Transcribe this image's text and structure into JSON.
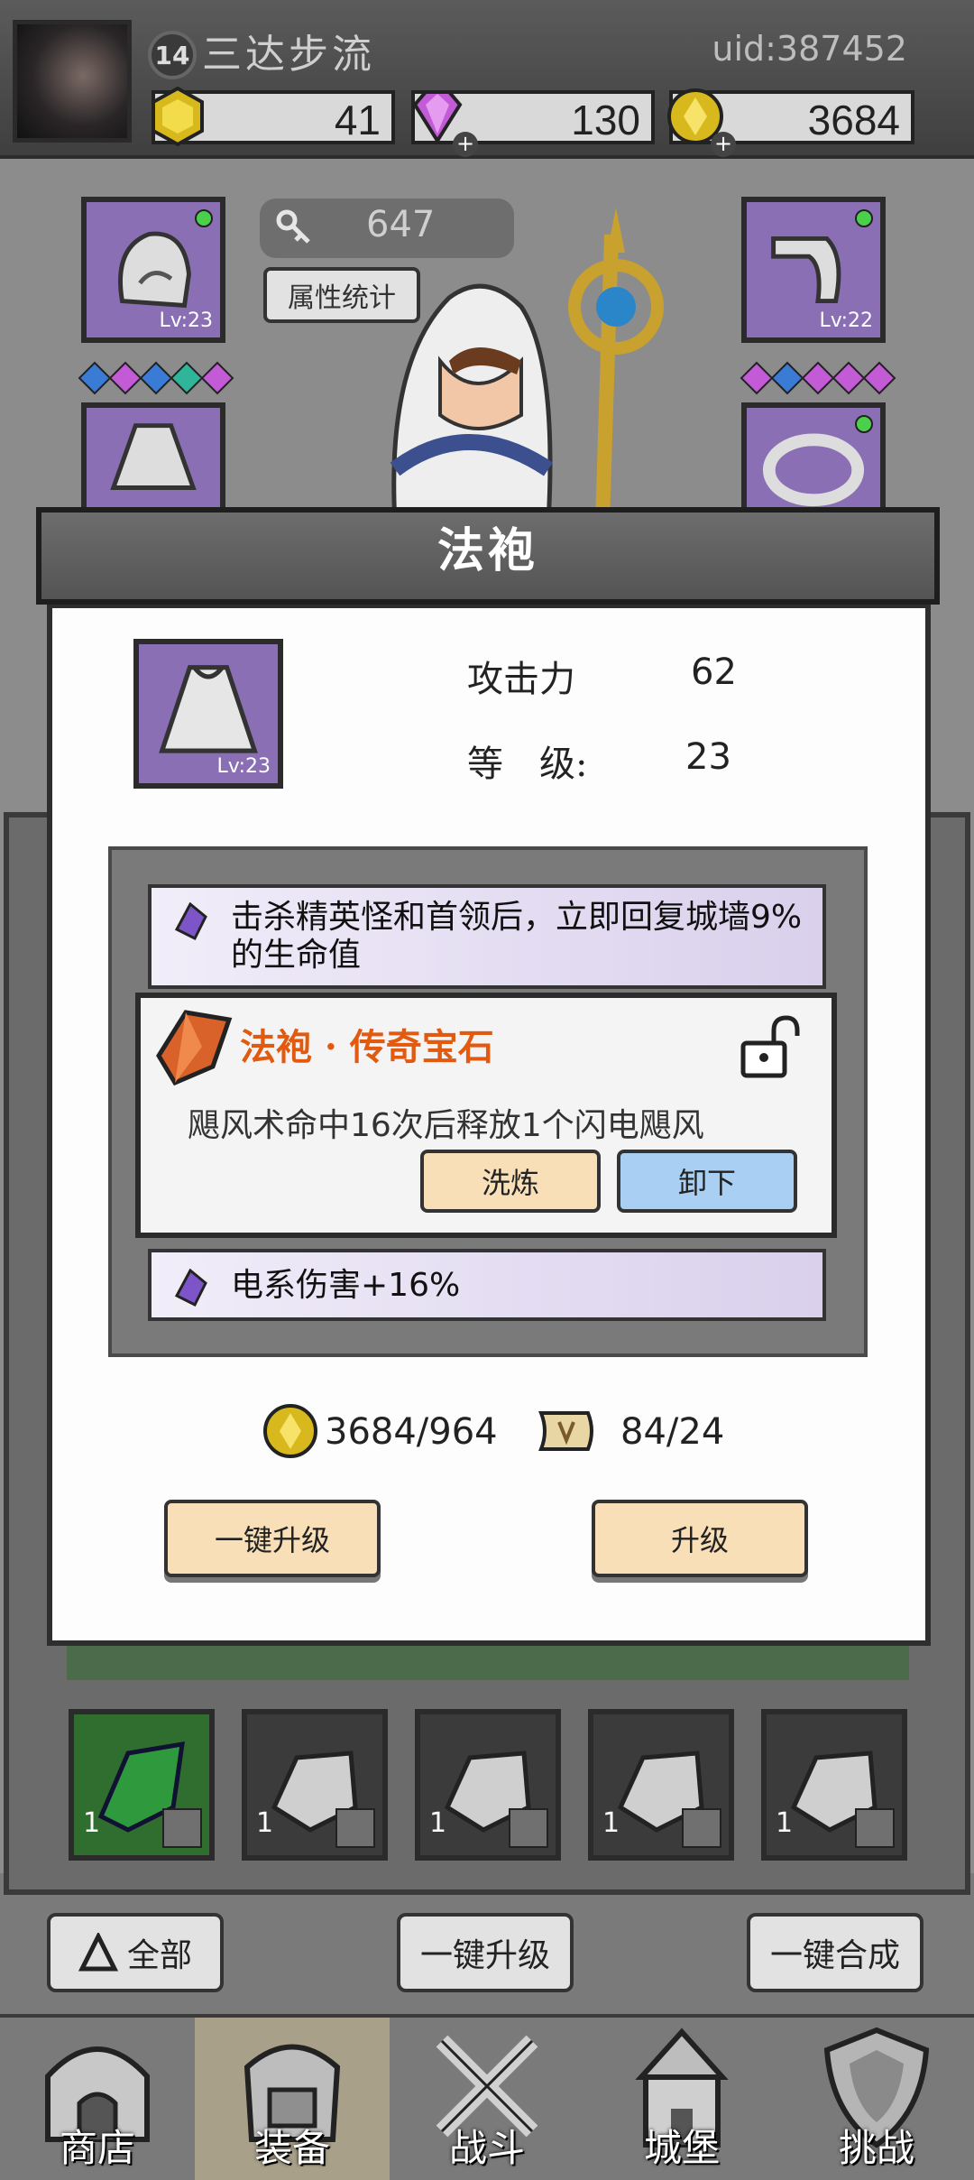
{
  "header": {
    "level": "14",
    "player_name": "三达步流",
    "uid": "uid:387452",
    "currencies": [
      {
        "icon": "gold-hexagon-icon",
        "value": "41"
      },
      {
        "icon": "purple-diamond-icon",
        "value": "130"
      },
      {
        "icon": "gold-coin-icon",
        "value": "3684"
      }
    ]
  },
  "hero": {
    "power": "647",
    "stats_button": "属性统计",
    "slots": [
      {
        "id": "helmet",
        "level": "Lv:23"
      },
      {
        "id": "gloves",
        "level": "Lv:22"
      }
    ]
  },
  "modal": {
    "title": "法袍",
    "item_level": "Lv:23",
    "stats": [
      {
        "label": "攻击力",
        "value": "62"
      },
      {
        "label": "等　级:",
        "value": "23"
      }
    ],
    "attributes": [
      {
        "text": "击杀精英怪和首领后，立即回复城墙9%的生命值"
      },
      {
        "text": "电系伤害+16%"
      }
    ],
    "legendary": {
      "title": "法袍 · 传奇宝石",
      "desc": "飓风术命中16次后释放1个闪电飓风",
      "refine": "洗炼",
      "unequip": "卸下"
    },
    "costs": [
      {
        "icon": "gold-coin-icon",
        "value": "3684/964"
      },
      {
        "icon": "scroll-icon",
        "value": "84/24"
      }
    ],
    "upgrade_all": "一键升级",
    "upgrade": "升级"
  },
  "inventory": {
    "items": [
      {
        "count": "1",
        "color": "green"
      },
      {
        "count": "1",
        "color": "gray"
      },
      {
        "count": "1",
        "color": "gray"
      },
      {
        "count": "1",
        "color": "gray"
      },
      {
        "count": "1",
        "color": "gray"
      }
    ],
    "filter_all": "全部",
    "upgrade_all": "一键升级",
    "merge_all": "一键合成"
  },
  "nav": [
    {
      "label": "商店"
    },
    {
      "label": "装备"
    },
    {
      "label": "战斗"
    },
    {
      "label": "城堡"
    },
    {
      "label": "挑战"
    }
  ],
  "colors": {
    "legend_title": "#e15a10",
    "purple_slot": "#8a6fb5",
    "button_cream": "#f8dfb8",
    "button_blue": "#a9cff2"
  }
}
